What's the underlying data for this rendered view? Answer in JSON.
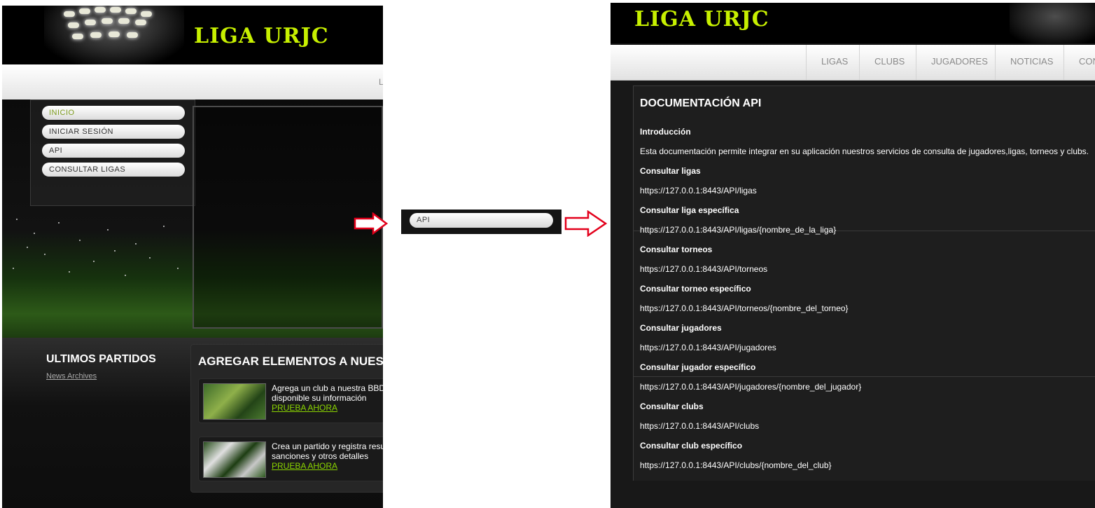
{
  "left": {
    "logo": "LIGA URJC",
    "nav_cut": "L",
    "menu": [
      {
        "label": "INICIO",
        "active": true
      },
      {
        "label": "INICIAR SESIÓN",
        "active": false
      },
      {
        "label": "API",
        "active": false
      },
      {
        "label": "CONSULTAR LIGAS",
        "active": false
      }
    ],
    "ultimos_title": "ULTIMOS PARTIDOS",
    "news_archives": "News Archives",
    "agregar_title": "AGREGAR ELEMENTOS A NUESTRA",
    "cards": [
      {
        "line1": "Agrega un club a nuestra BBDD",
        "line2": "disponible su información",
        "link": "PRUEBA AHORA"
      },
      {
        "line1": "Crea un partido y registra resultados",
        "line2": "sanciones y otros detalles",
        "link": "PRUEBA AHORA"
      }
    ]
  },
  "middle": {
    "api_label": "API"
  },
  "right": {
    "logo": "LIGA URJC",
    "nav": [
      "LIGAS",
      "CLUBS",
      "JUGADORES",
      "NOTICIAS",
      "CONTACTO"
    ],
    "title": "DOCUMENTACIÓN API",
    "lines": [
      {
        "text": "Introducción",
        "bold": true
      },
      {
        "text": "Esta documentación permite integrar en su aplicación nuestros servicios de consulta de jugadores,ligas, torneos y clubs.",
        "bold": false
      },
      {
        "text": "Consultar ligas",
        "bold": true
      },
      {
        "text": "https://127.0.0.1:8443/API/ligas",
        "bold": false
      },
      {
        "text": "Consultar liga específica",
        "bold": true
      },
      {
        "text": "https://127.0.0.1:8443/API/ligas/{nombre_de_la_liga}",
        "bold": false
      },
      {
        "text": "Consultar torneos",
        "bold": true
      },
      {
        "text": "https://127.0.0.1:8443/API/torneos",
        "bold": false
      },
      {
        "text": "Consultar torneo específico",
        "bold": true
      },
      {
        "text": "https://127.0.0.1:8443/API/torneos/{nombre_del_torneo}",
        "bold": false
      },
      {
        "text": "Consultar jugadores",
        "bold": true
      },
      {
        "text": "https://127.0.0.1:8443/API/jugadores",
        "bold": false
      },
      {
        "text": "Consultar jugador específico",
        "bold": true
      },
      {
        "text": "https://127.0.0.1:8443/API/jugadores/{nombre_del_jugador}",
        "bold": false
      },
      {
        "text": "Consultar clubs",
        "bold": true
      },
      {
        "text": "https://127.0.0.1:8443/API/clubs",
        "bold": false
      },
      {
        "text": "Consultar club específico",
        "bold": true
      },
      {
        "text": "https://127.0.0.1:8443/API/clubs/{nombre_del_club}",
        "bold": false
      }
    ]
  },
  "colors": {
    "logo": "#c7f000",
    "link": "#8ad400",
    "active_menu": "#7d9c1e",
    "arrow": "#e3001b"
  }
}
